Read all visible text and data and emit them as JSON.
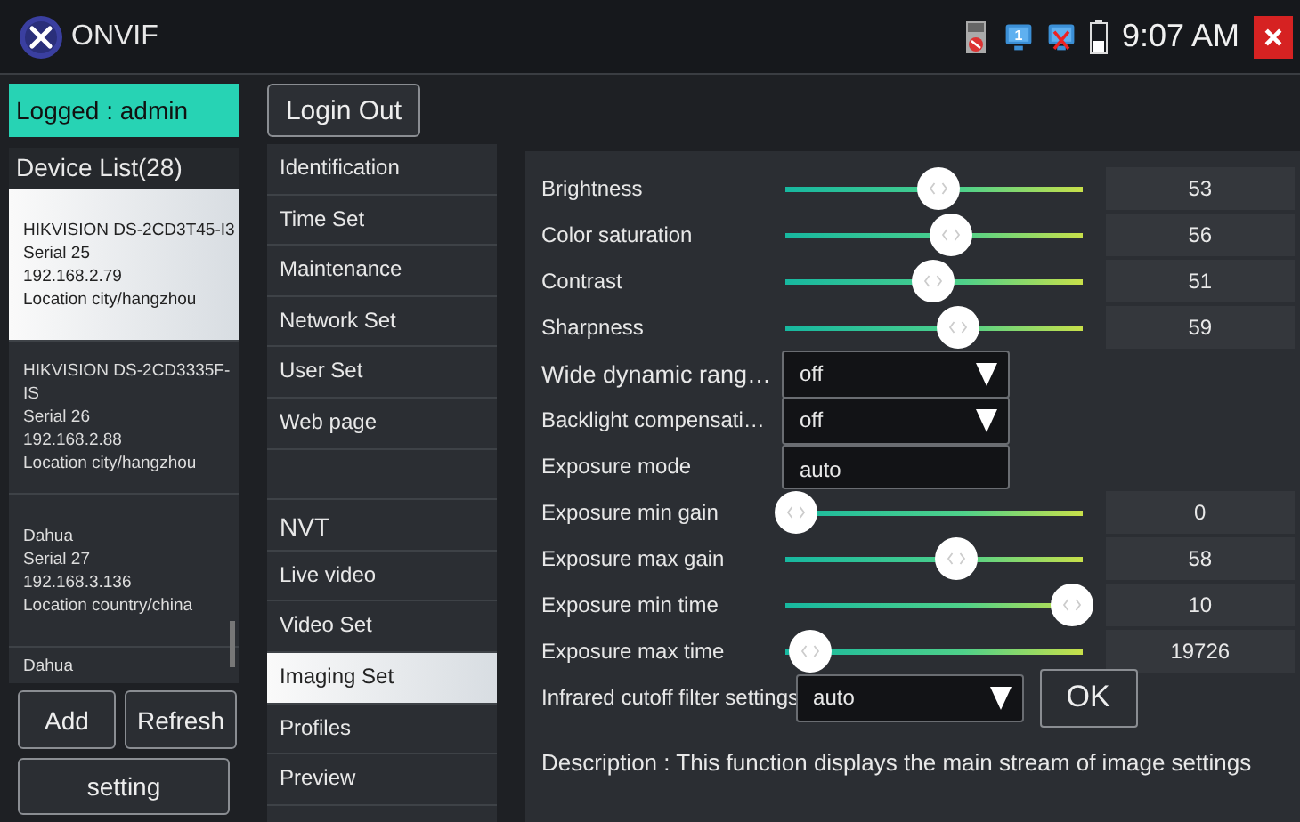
{
  "title_bar": {
    "app_name": "ONVIF",
    "monitor_one": "1",
    "time": "9:07 AM"
  },
  "logged_in": "Logged : admin",
  "device_list": {
    "header": "Device List(28)",
    "items": [
      {
        "name": "HIKVISION DS-2CD3T45-I3",
        "serial": "Serial  25",
        "ip": "192.168.2.79",
        "location": "Location  city/hangzhou",
        "selected": true
      },
      {
        "name": "HIKVISION DS-2CD3335F-IS",
        "serial": "Serial  26",
        "ip": "192.168.2.88",
        "location": "Location  city/hangzhou",
        "selected": false
      },
      {
        "name": "Dahua",
        "serial": "Serial  27",
        "ip": "192.168.3.136",
        "location": "Location  country/china",
        "selected": false
      },
      {
        "name": "Dahua",
        "selected": false
      }
    ]
  },
  "left_buttons": [
    "Add",
    "Refresh"
  ],
  "setting_button": "setting",
  "login_out_button": "Login Out",
  "menu": [
    {
      "kind": "item",
      "label": "Identification",
      "selected": false
    },
    {
      "kind": "item",
      "label": "Time Set",
      "selected": false
    },
    {
      "kind": "item",
      "label": "Maintenance",
      "selected": false
    },
    {
      "kind": "item",
      "label": "Network Set",
      "selected": false
    },
    {
      "kind": "item",
      "label": "User Set",
      "selected": false
    },
    {
      "kind": "item",
      "label": "Web page",
      "selected": false
    },
    {
      "kind": "blank"
    },
    {
      "kind": "header",
      "label": "NVT"
    },
    {
      "kind": "item",
      "label": "Live video",
      "selected": false
    },
    {
      "kind": "item",
      "label": "Video Set",
      "selected": false
    },
    {
      "kind": "item",
      "label": "Imaging Set",
      "selected": true
    },
    {
      "kind": "item",
      "label": "Profiles",
      "selected": false
    },
    {
      "kind": "item",
      "label": "Preview",
      "selected": false
    }
  ],
  "settings": [
    {
      "kind": "slider",
      "label": "Brightness",
      "level": 0.52,
      "value": "53"
    },
    {
      "kind": "slider",
      "label": "Color saturation",
      "level": 0.56,
      "value": "56"
    },
    {
      "kind": "slider",
      "label": "Contrast",
      "level": 0.5,
      "value": "51"
    },
    {
      "kind": "slider",
      "label": "Sharpness",
      "level": 0.59,
      "value": "59"
    },
    {
      "kind": "select",
      "label": "Wide dynamic rang…",
      "value": "off",
      "large": true
    },
    {
      "kind": "select",
      "label": "Backlight compensati…",
      "value": "off"
    },
    {
      "kind": "field",
      "label": "Exposure mode",
      "value": "auto"
    },
    {
      "kind": "slider",
      "label": "Exposure min gain",
      "level": 0,
      "value": "0"
    },
    {
      "kind": "slider",
      "label": "Exposure max gain",
      "level": 0.58,
      "value": "58"
    },
    {
      "kind": "slider",
      "label": "Exposure min time",
      "level": 1,
      "value": "10"
    },
    {
      "kind": "slider",
      "label": "Exposure max time",
      "level": 0.05,
      "value": "19726"
    },
    {
      "kind": "select",
      "label": "Infrared cutoff filter settings",
      "value": "auto",
      "button": "OK"
    }
  ],
  "description": "Description : This function displays the main stream of image settings"
}
